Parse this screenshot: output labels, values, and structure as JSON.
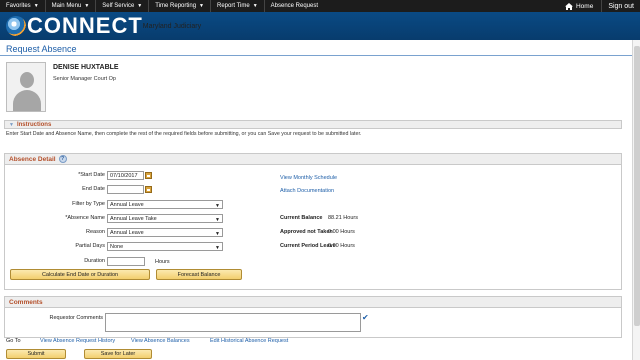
{
  "nav": {
    "crumbs": [
      "Favorites",
      "Main Menu",
      "Self Service",
      "Time Reporting",
      "Report Time",
      "Absence Request"
    ],
    "home_label": "Home",
    "signout_label": "Sign out"
  },
  "brand": {
    "name": "CONNECT",
    "tagline": "Maryland Judiciary"
  },
  "page": {
    "title": "Request Absence"
  },
  "employee": {
    "name": "DENISE HUXTABLE",
    "title": "Senior Manager Court Op"
  },
  "instructions": {
    "header": "Instructions",
    "text": "Enter Start Date and Absence Name, then complete the rest of the required fields before submitting, or you can Save your request to be submitted later."
  },
  "detail": {
    "header": "Absence Detail",
    "start_label": "*Start Date",
    "start_value": "07/10/2017",
    "end_label": "End Date",
    "end_value": "",
    "filter_label": "Filter by Type",
    "filter_value": "Annual Leave",
    "absence_label": "*Absence Name",
    "absence_value": "Annual Leave Take",
    "reason_label": "Reason",
    "reason_value": "Annual Leave",
    "partial_label": "Partial Days",
    "partial_value": "None",
    "duration_label": "Duration",
    "duration_value": "",
    "hours_label": "Hours",
    "calc_button": "Calculate End Date or Duration",
    "forecast_button": "Forecast Balance",
    "monthly_link": "View Monthly Schedule",
    "attach_link": "Attach Documentation",
    "current_balance_label": "Current Balance",
    "current_balance_value": "88.21 Hours",
    "approved_label": "Approved not Taken",
    "approved_value": "0.00 Hours",
    "period_label": "Current Period Leave",
    "period_value": "0.00 Hours"
  },
  "comments": {
    "header": "Comments",
    "requestor_label": "Requestor Comments",
    "requestor_value": ""
  },
  "goto": {
    "label": "Go To",
    "links": [
      "View Absence Request History",
      "View Absence Balances",
      "Edit Historical Absence Request"
    ]
  },
  "actions": {
    "submit": "Submit",
    "save_later": "Save for Later"
  }
}
